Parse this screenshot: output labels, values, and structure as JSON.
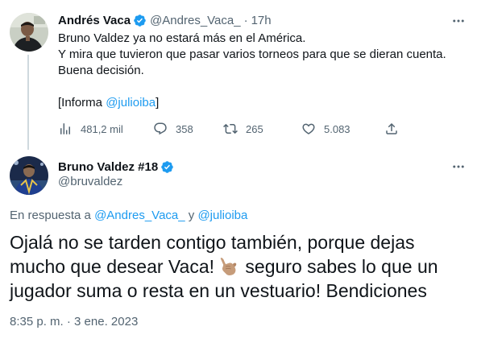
{
  "colors": {
    "link": "#1d9bf0",
    "verified": "#1d9bf0",
    "secondary_text": "#536471",
    "primary_text": "#0f1419",
    "thread_line": "#cfd9de"
  },
  "tweet1": {
    "author_name": "Andrés Vaca",
    "handle": "@Andres_Vaca_",
    "separator": "·",
    "time": "17h",
    "text_lines": [
      "Bruno Valdez ya no estará más en el América.",
      "Y mira que tuvieron que pasar varios torneos para que se dieran cuenta.",
      "Buena decisión."
    ],
    "informa_prefix": "[Informa ",
    "informa_mention": "@julioiba",
    "informa_suffix": "]",
    "stats": {
      "views": "481,2 mil",
      "replies": "358",
      "retweets": "265",
      "likes": "5.083"
    }
  },
  "tweet2": {
    "author_name": "Bruno Valdez #18",
    "handle": "@bruvaldez",
    "reply_prefix": "En respuesta a ",
    "reply_mention1": "@Andres_Vaca_",
    "reply_and": " y ",
    "reply_mention2": "@julioiba",
    "text_line1": "Ojalá no se tarden contigo también, porque dejas",
    "text_line2_before": "mucho que desear Vaca!",
    "text_line2_after": " seguro sabes lo que un",
    "text_line3": "jugador suma o resta en un vestuario! Bendiciones",
    "emoji_name": "call-me-hand-emoji",
    "time": "8:35 p. m.",
    "separator": "·",
    "date": "3 ene. 2023"
  },
  "icons": {
    "verified": "verified-badge-icon",
    "more": "more-options-icon",
    "views": "views-chart-icon",
    "reply": "reply-bubble-icon",
    "retweet": "retweet-icon",
    "like": "heart-icon",
    "share": "share-icon"
  }
}
